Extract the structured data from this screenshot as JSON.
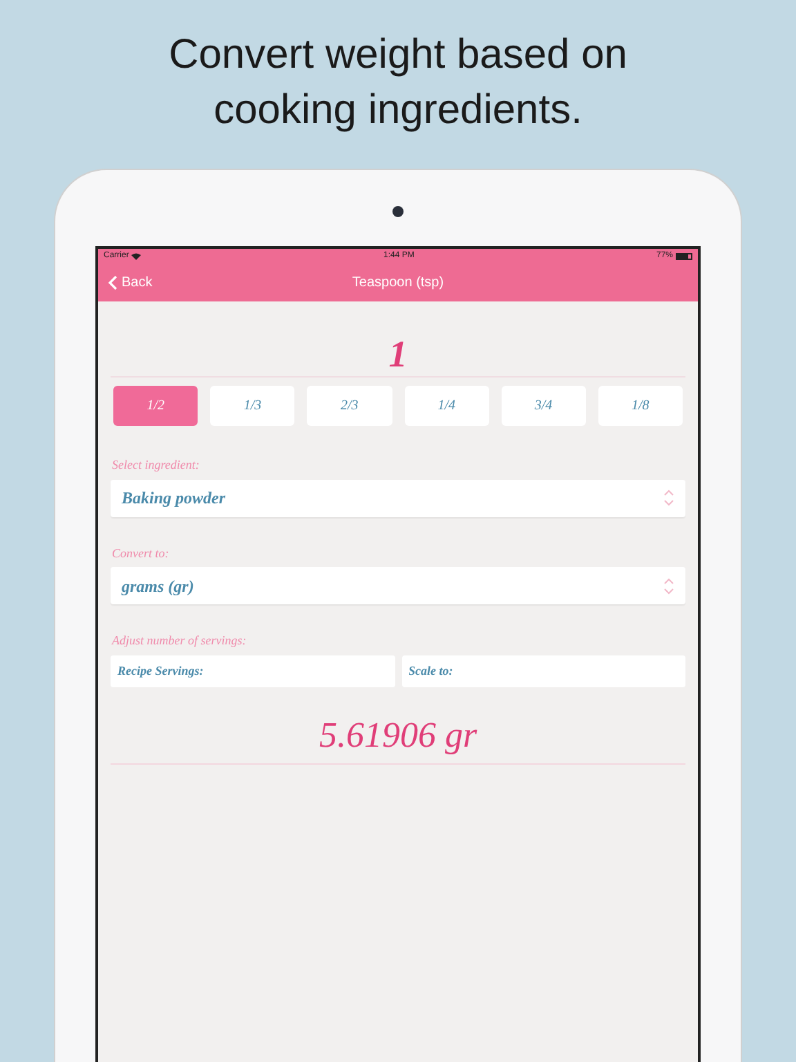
{
  "headline": "Convert weight based on cooking ingredients.",
  "status_bar": {
    "carrier": "Carrier",
    "time": "1:44 PM",
    "battery": {
      "label": "77%",
      "level": 0.77
    }
  },
  "nav_bar": {
    "back": "Back",
    "title": "Teaspoon (tsp)"
  },
  "amount": "1",
  "fractions": [
    {
      "label": "1/2",
      "selected": true
    },
    {
      "label": "1/3",
      "selected": false
    },
    {
      "label": "2/3",
      "selected": false
    },
    {
      "label": "1/4",
      "selected": false
    },
    {
      "label": "3/4",
      "selected": false
    },
    {
      "label": "1/8",
      "selected": false
    }
  ],
  "ingredient": {
    "label": "Select ingredient:",
    "value": "Baking powder"
  },
  "convert_to": {
    "label": "Convert to:",
    "value": "grams (gr)"
  },
  "servings": {
    "label": "Adjust number of servings:",
    "fields": [
      {
        "placeholder": "Recipe Servings:"
      },
      {
        "placeholder": "Scale to:"
      }
    ]
  },
  "result": "5.61906 gr"
}
